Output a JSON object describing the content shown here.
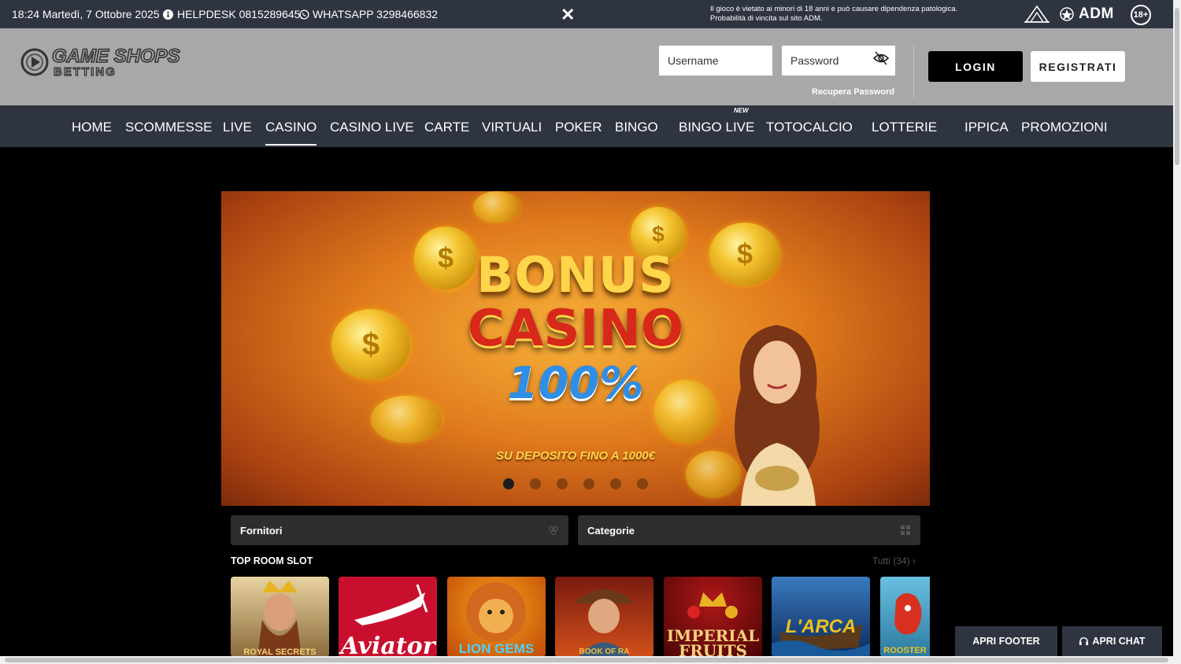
{
  "topbar": {
    "datetime": "18:24 Martedì, 7 Ottobre 2025",
    "helpdesk": "HELPDESK 0815289645",
    "whatsapp": "WHATSAPP 3298466832",
    "warning_line1": "Il gioco è vietato ai minori di 18 anni e può causare dipendenza patologica.",
    "warning_line2": "Probabilità di vincita sul sito ADM.",
    "adm": "ADM",
    "age": "18+",
    "close_icon": "close-icon",
    "info_icon": "info-icon",
    "whatsapp_icon": "whatsapp-icon"
  },
  "header": {
    "logo_main": "GAME SHOPS",
    "logo_sub": "BETTING",
    "username_placeholder": "Username",
    "password_placeholder": "Password",
    "recupera": "Recupera Password",
    "login": "LOGIN",
    "registrati": "REGISTRATI"
  },
  "nav": {
    "items": [
      {
        "label": "HOME"
      },
      {
        "label": "SCOMMESSE"
      },
      {
        "label": "LIVE"
      },
      {
        "label": "CASINO",
        "active": true
      },
      {
        "label": "CASINO LIVE"
      },
      {
        "label": "CARTE"
      },
      {
        "label": "VIRTUALI"
      },
      {
        "label": "POKER"
      },
      {
        "label": "BINGO"
      },
      {
        "label": "BINGO LIVE"
      },
      {
        "label": "TOTOCALCIO"
      },
      {
        "label": "LOTTERIE"
      },
      {
        "label": "IPPICA"
      },
      {
        "label": "PROMOZIONI"
      }
    ],
    "new_badge": "NEW"
  },
  "banner": {
    "title1": "BONUS",
    "title2": "CASINO",
    "percent": "100%",
    "subtitle": "SU DEPOSITO FINO A 1000€",
    "slides": 6,
    "active_slide": 1
  },
  "filters": {
    "fornitori": "Fornitori",
    "categorie": "Categorie"
  },
  "section": {
    "title": "TOP ROOM SLOT",
    "tutti": "Tutti (34)"
  },
  "games": [
    {
      "name": "ROYAL SECRETS"
    },
    {
      "name": "Aviator"
    },
    {
      "name": "LION GEMS"
    },
    {
      "name": "BOOK OF RA"
    },
    {
      "name": "IMPERIAL FRUITS"
    },
    {
      "name": "L'ARCA"
    },
    {
      "name": "ROOSTER"
    }
  ],
  "footer_buttons": {
    "apri_footer": "APRI FOOTER",
    "apri_chat": "APRI CHAT"
  },
  "colors": {
    "bar": "#2f3441",
    "header": "#a8a8a8",
    "background": "#000000"
  }
}
